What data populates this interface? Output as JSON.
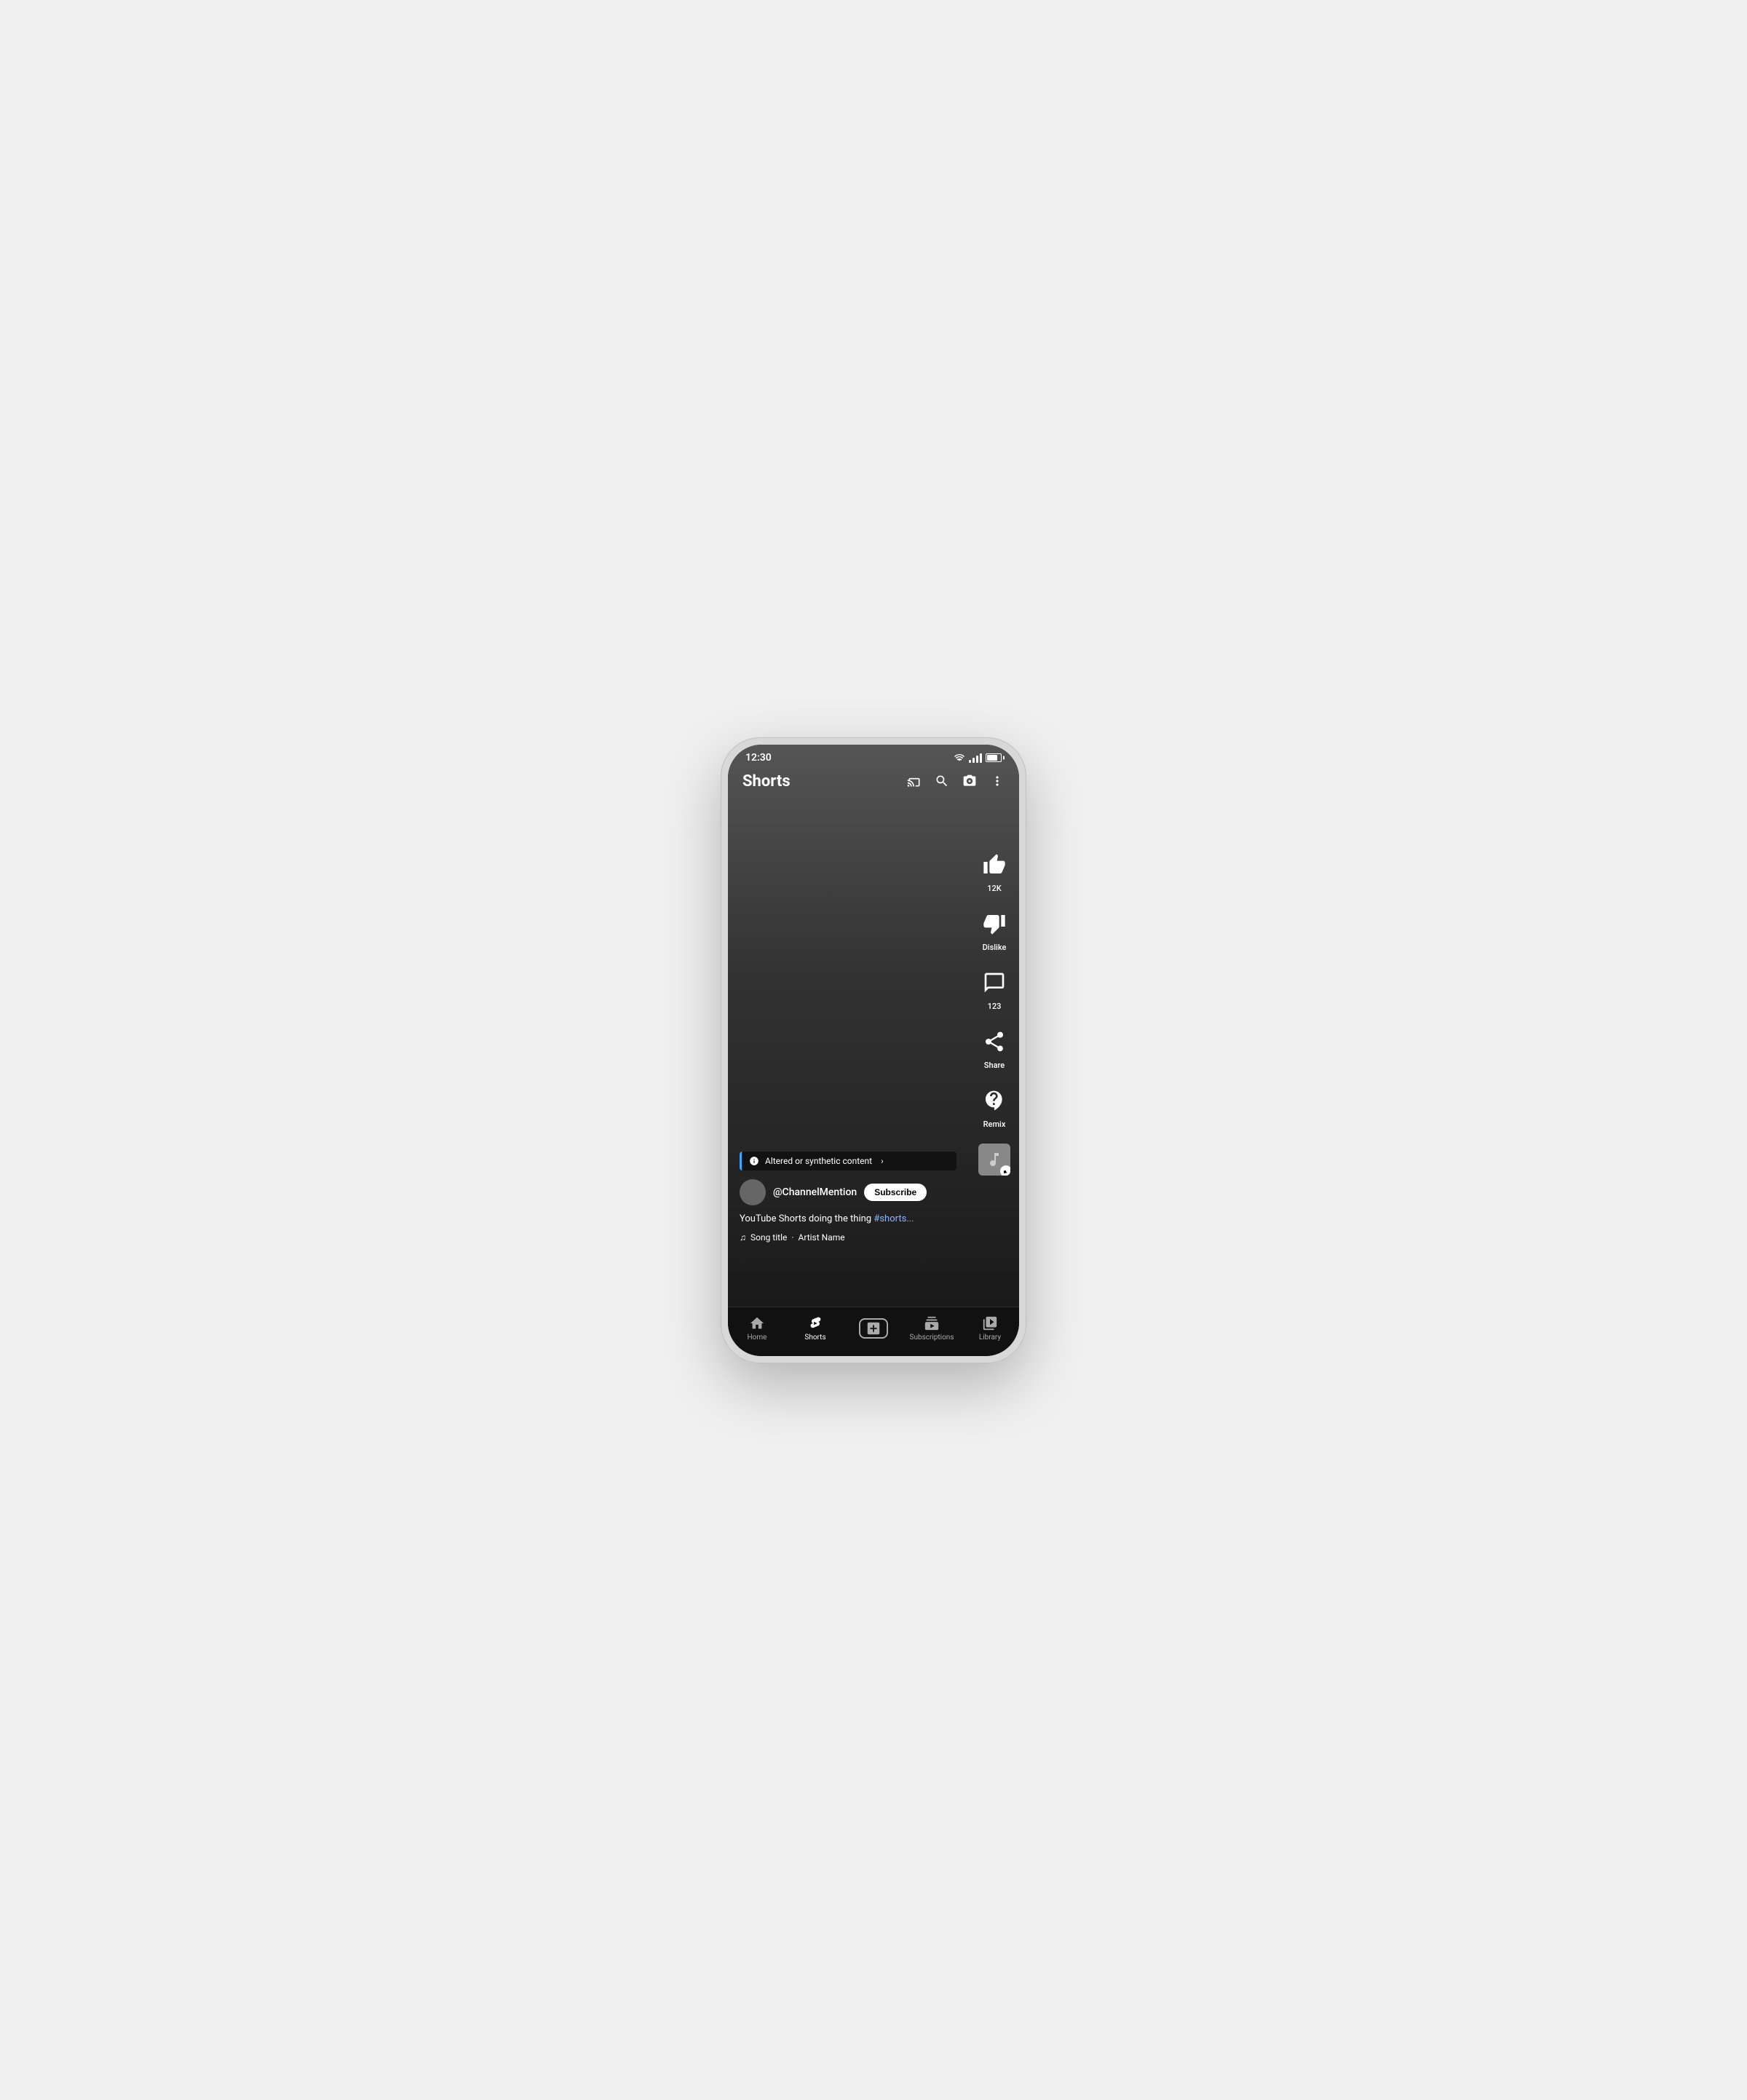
{
  "status": {
    "time": "12:30",
    "battery": 75
  },
  "appbar": {
    "title": "Shorts",
    "icons": {
      "cast": "cast-icon",
      "search": "search-icon",
      "camera": "camera-icon",
      "more": "more-icon"
    }
  },
  "actions": {
    "like_count": "12K",
    "like_label": "12K",
    "dislike_label": "Dislike",
    "comments_count": "123",
    "share_label": "Share",
    "remix_label": "Remix"
  },
  "content": {
    "synthetic_banner": "Altered or synthetic content",
    "channel_name": "@ChannelMention",
    "subscribe_label": "Subscribe",
    "description": "YouTube Shorts doing the thing #shorts...",
    "hashtag": "#shorts...",
    "song_title": "Song title",
    "artist_name": "Artist Name"
  },
  "nav": {
    "items": [
      {
        "id": "home",
        "label": "Home",
        "active": false
      },
      {
        "id": "shorts",
        "label": "Shorts",
        "active": true
      },
      {
        "id": "create",
        "label": "",
        "active": false
      },
      {
        "id": "subscriptions",
        "label": "Subscriptions",
        "active": false
      },
      {
        "id": "library",
        "label": "Library",
        "active": false
      }
    ]
  }
}
